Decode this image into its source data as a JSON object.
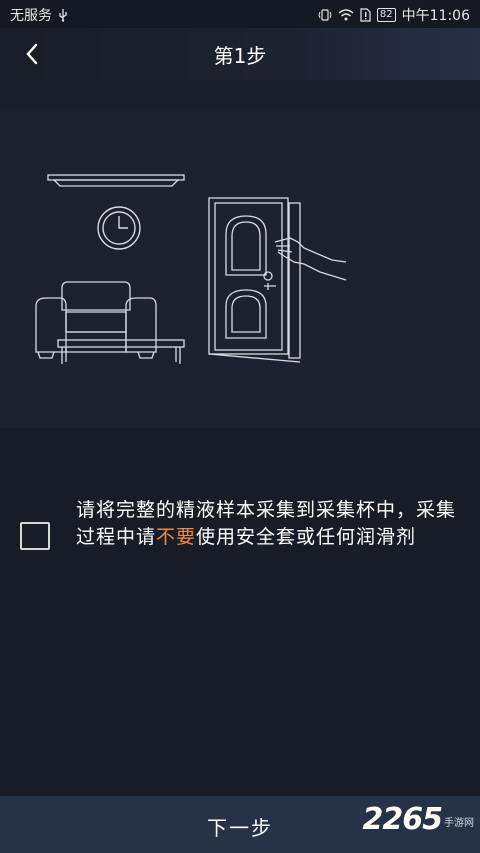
{
  "status_bar": {
    "carrier": "无服务",
    "usb_icon": "usb-icon",
    "battery": "82",
    "time": "中午11:06"
  },
  "nav": {
    "title": "第1步",
    "back_icon": "chevron-left-icon"
  },
  "illustration": {
    "icons": [
      "shelf-icon",
      "clock-icon",
      "sofa-icon",
      "coffee-table-icon",
      "door-icon",
      "hand-icon"
    ]
  },
  "instruction": {
    "part1": "请将完整的精液样本采集到采集杯中，采集过程中请",
    "highlight": "不要",
    "part2": "使用安全套或任何润滑剂",
    "highlight_color": "#f08a3c"
  },
  "footer": {
    "next_label": "下一步"
  },
  "watermark": {
    "number": "2265",
    "suffix": "手游网"
  }
}
